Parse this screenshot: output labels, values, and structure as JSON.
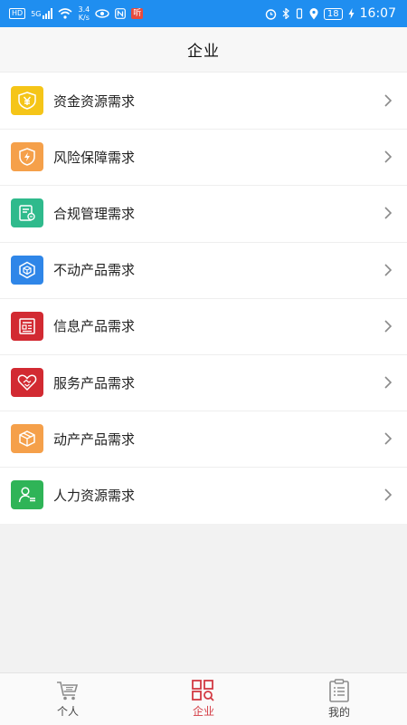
{
  "status_bar": {
    "hd_label": "HD",
    "net_label": "5G",
    "speed_value": "3.4",
    "speed_unit": "K/s",
    "news_badge": "听",
    "battery": "18",
    "time": "16:07"
  },
  "header": {
    "title": "企业"
  },
  "list": [
    {
      "label": "资金资源需求",
      "icon": "yen-icon",
      "color": "#f5c518"
    },
    {
      "label": "风险保障需求",
      "icon": "shield-bolt-icon",
      "color": "#f5a04a"
    },
    {
      "label": "合规管理需求",
      "icon": "document-cert-icon",
      "color": "#2fba8c"
    },
    {
      "label": "不动产品需求",
      "icon": "cube-icon",
      "color": "#2f86e8"
    },
    {
      "label": "信息产品需求",
      "icon": "newspaper-icon",
      "color": "#d22a32"
    },
    {
      "label": "服务产品需求",
      "icon": "handshake-heart-icon",
      "color": "#d22a32"
    },
    {
      "label": "动产产品需求",
      "icon": "box-icon",
      "color": "#f5a04a"
    },
    {
      "label": "人力资源需求",
      "icon": "person-list-icon",
      "color": "#2fb457"
    }
  ],
  "tabs": [
    {
      "label": "个人",
      "icon": "cart-icon",
      "active": false
    },
    {
      "label": "企业",
      "icon": "grid-search-icon",
      "active": true
    },
    {
      "label": "我的",
      "icon": "clipboard-icon",
      "active": false
    }
  ],
  "colors": {
    "status_bar": "#1f8ef0",
    "active_tab": "#d33a43"
  }
}
